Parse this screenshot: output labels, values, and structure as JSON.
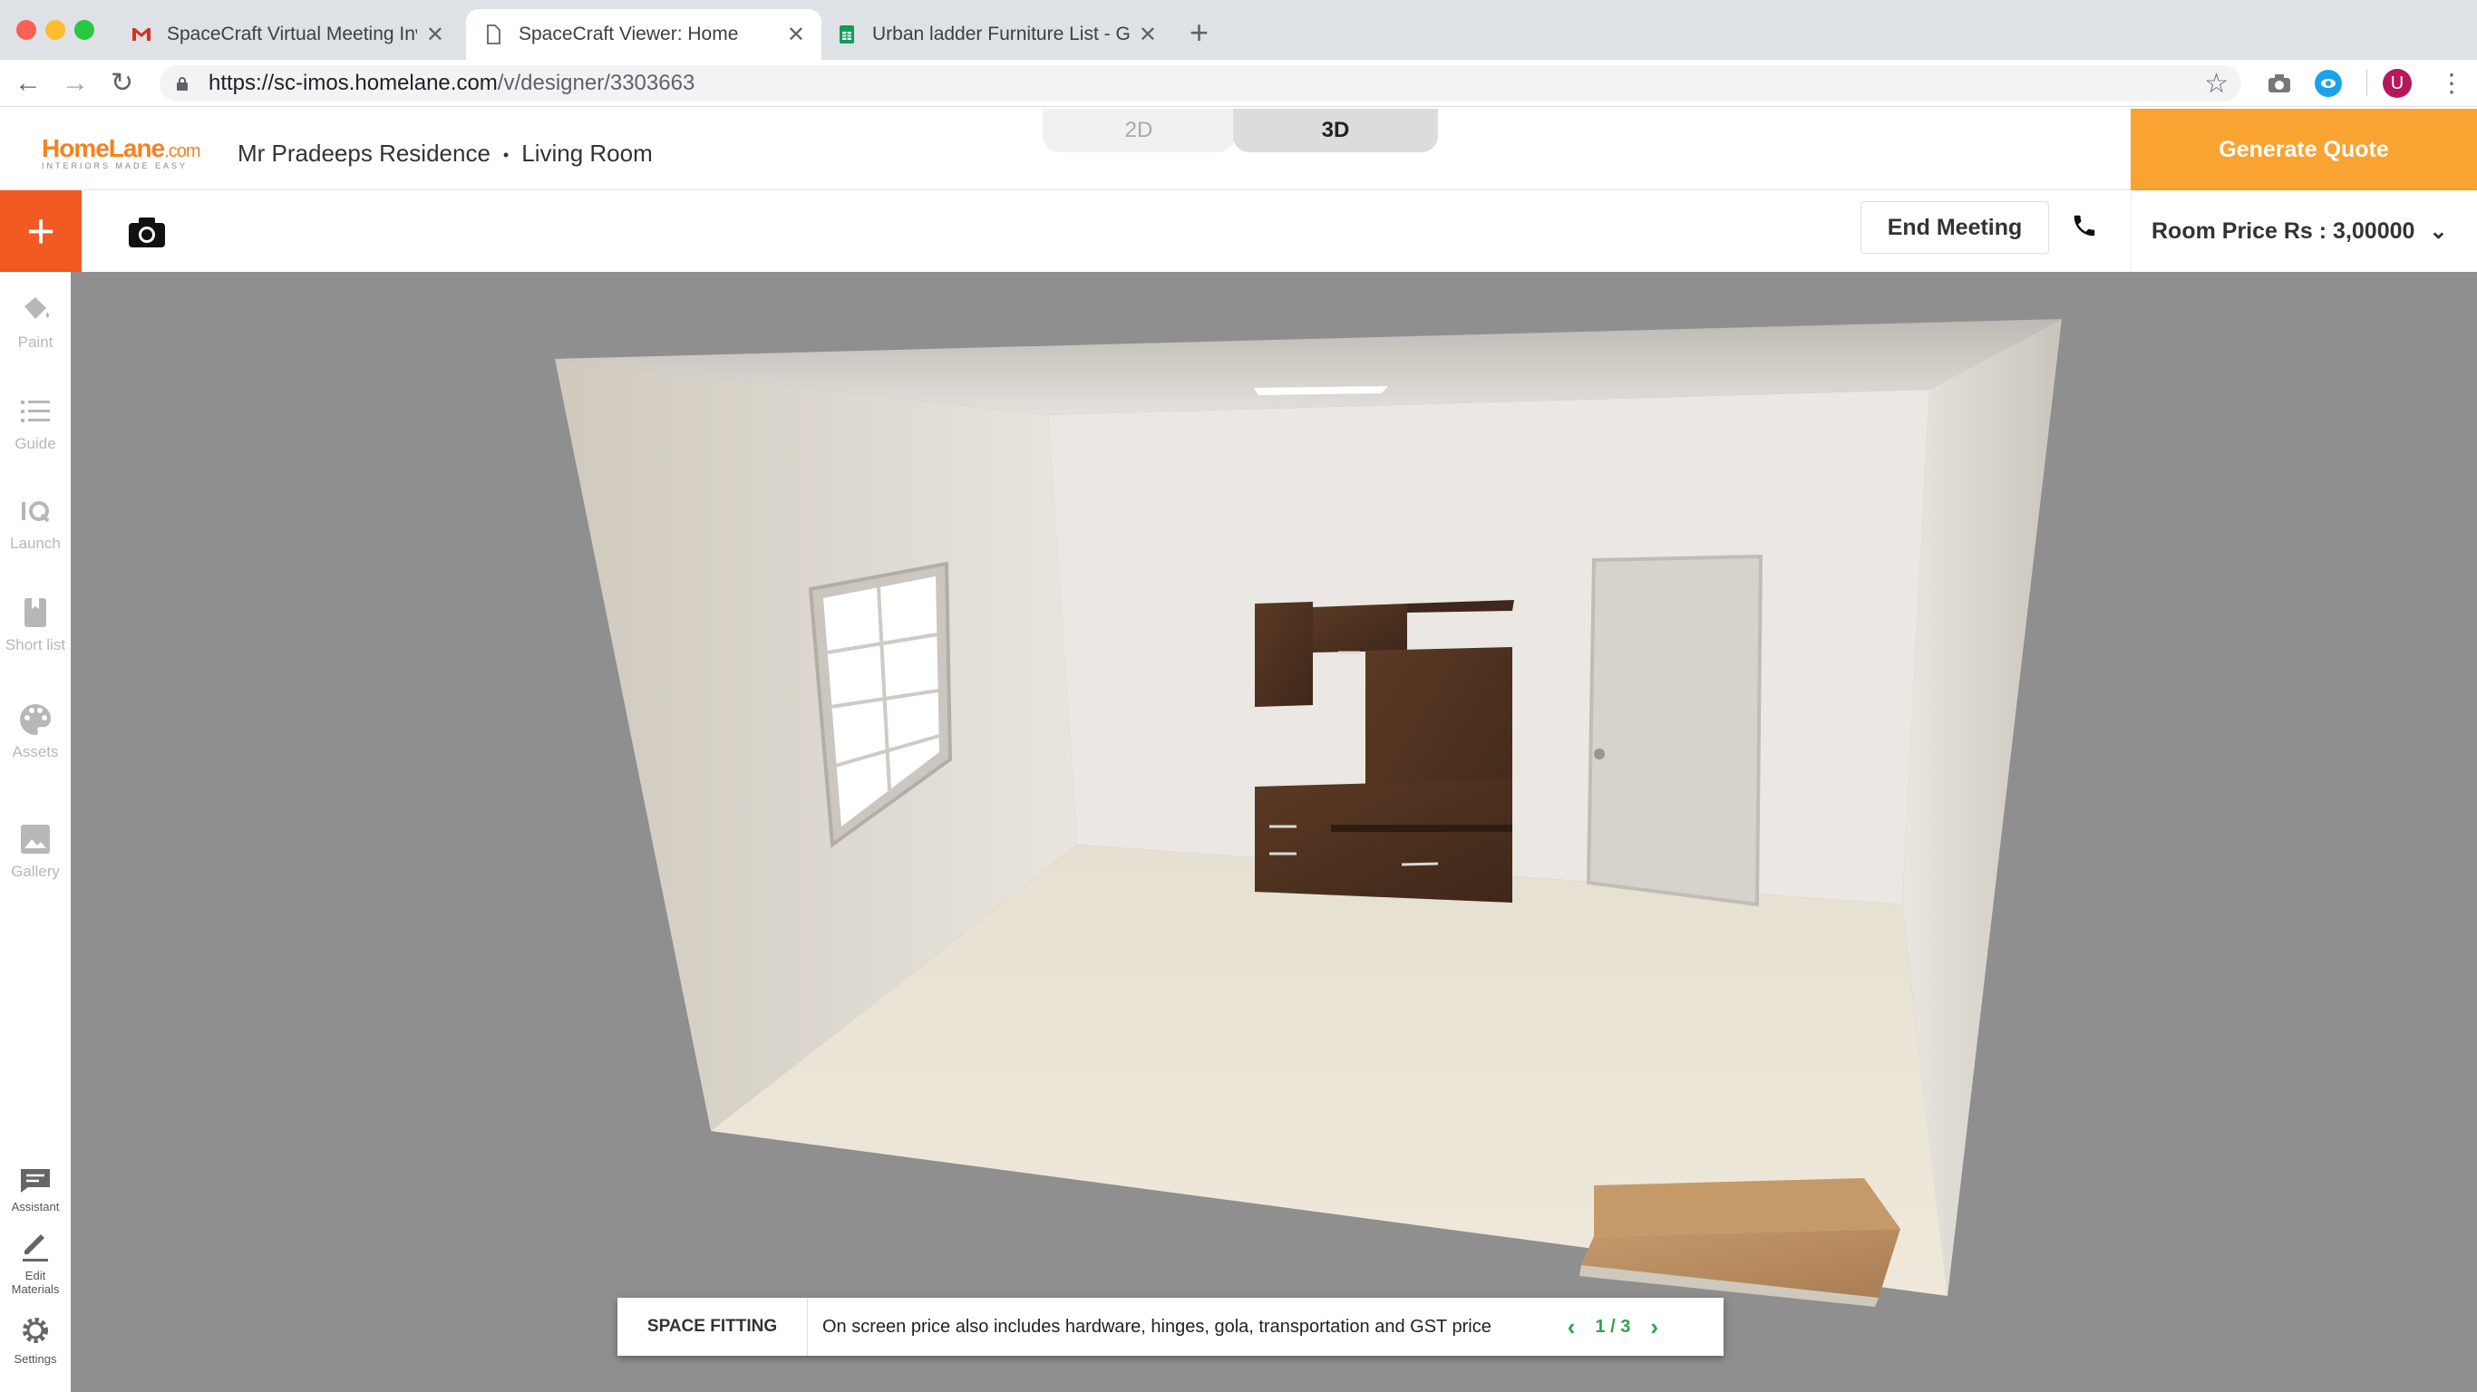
{
  "browser": {
    "tabs": [
      {
        "title": "SpaceCraft Virtual Meeting Inv",
        "icon": "gmail-icon"
      },
      {
        "title": "SpaceCraft Viewer: Home",
        "icon": "page-icon"
      },
      {
        "title": "Urban ladder Furniture List - G",
        "icon": "sheets-icon"
      }
    ],
    "url_host": "https://sc-imos.homelane.com",
    "url_path": "/v/designer/3303663",
    "profile_initial": "U"
  },
  "header": {
    "logo_brand": "HomeLane",
    "logo_suffix": ".com",
    "logo_tagline": "INTERIORS MADE EASY",
    "project": "Mr Pradeeps Residence",
    "separator": "•",
    "room": "Living Room",
    "view_2d": "2D",
    "view_3d": "3D",
    "active_view": "3D",
    "generate_quote": "Generate Quote",
    "accent_color": "#f8a332"
  },
  "toolbar": {
    "add": "+",
    "end_meeting": "End Meeting",
    "room_price": "Room Price Rs : 3,00000"
  },
  "sidebar": {
    "items": [
      {
        "label": "Paint",
        "icon": "paint-bucket-icon"
      },
      {
        "label": "Guide",
        "icon": "list-icon"
      },
      {
        "label": "Launch",
        "icon": "iq-icon"
      },
      {
        "label": "Short list",
        "icon": "bookmark-icon"
      },
      {
        "label": "Assets",
        "icon": "palette-icon"
      },
      {
        "label": "Gallery",
        "icon": "image-icon"
      }
    ],
    "bottom_items": [
      {
        "label": "Assistant",
        "icon": "assistant-icon"
      },
      {
        "label": "Edit Materials",
        "icon": "edit-icon"
      },
      {
        "label": "Settings",
        "icon": "gear-icon"
      }
    ]
  },
  "banner": {
    "label": "SPACE FITTING",
    "message": "On screen price also includes hardware, hinges, gola, transportation and GST price",
    "page": "1 / 3"
  }
}
